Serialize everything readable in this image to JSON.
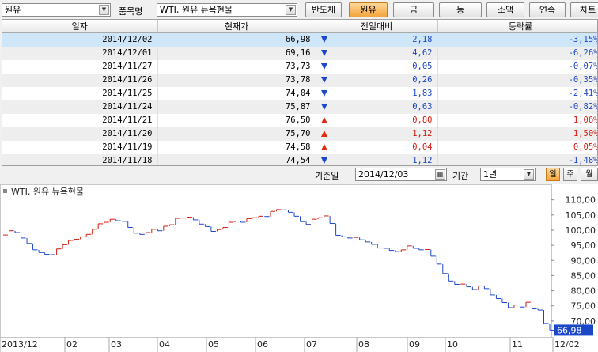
{
  "toolbar": {
    "category_value": "원유",
    "item_label": "품목명",
    "item_value": "WTI, 원유 뉴욕현물",
    "buttons": [
      {
        "label": "반도체",
        "active": false
      },
      {
        "label": "원유",
        "active": true
      },
      {
        "label": "금",
        "active": false
      },
      {
        "label": "동",
        "active": false
      },
      {
        "label": "소맥",
        "active": false
      },
      {
        "label": "연속",
        "active": false
      },
      {
        "label": "차트",
        "active": false
      }
    ]
  },
  "table": {
    "headers": [
      "일자",
      "현재가",
      "전일대비",
      "등락률"
    ],
    "rows": [
      {
        "date": "2014/12/02",
        "price": "66,98",
        "dir": "down",
        "change": "2,18",
        "rate": "-3,15%"
      },
      {
        "date": "2014/12/01",
        "price": "69,16",
        "dir": "down",
        "change": "4,62",
        "rate": "-6,26%"
      },
      {
        "date": "2014/11/27",
        "price": "73,73",
        "dir": "down",
        "change": "0,05",
        "rate": "-0,07%"
      },
      {
        "date": "2014/11/26",
        "price": "73,78",
        "dir": "down",
        "change": "0,26",
        "rate": "-0,35%"
      },
      {
        "date": "2014/11/25",
        "price": "74,04",
        "dir": "down",
        "change": "1,83",
        "rate": "-2,41%"
      },
      {
        "date": "2014/11/24",
        "price": "75,87",
        "dir": "down",
        "change": "0,63",
        "rate": "-0,82%"
      },
      {
        "date": "2014/11/21",
        "price": "76,50",
        "dir": "up",
        "change": "0,80",
        "rate": "1,06%"
      },
      {
        "date": "2014/11/20",
        "price": "75,70",
        "dir": "up",
        "change": "1,12",
        "rate": "1,50%"
      },
      {
        "date": "2014/11/19",
        "price": "74,58",
        "dir": "up",
        "change": "0,04",
        "rate": "0,05%"
      },
      {
        "date": "2014/11/18",
        "price": "74,54",
        "dir": "down",
        "change": "1,12",
        "rate": "-1,48%"
      }
    ]
  },
  "controls": {
    "base_date_label": "기준일",
    "base_date_value": "2014/12/03",
    "period_label": "기간",
    "period_value": "1년",
    "tabs": [
      {
        "label": "일",
        "active": true
      },
      {
        "label": "주",
        "active": false
      },
      {
        "label": "월",
        "active": false
      }
    ]
  },
  "chart_data": {
    "type": "line",
    "title": "WTI, 원유 뉴욕현물",
    "x": [
      "2013/12",
      "02",
      "03",
      "04",
      "05",
      "06",
      "07",
      "08",
      "09",
      "10",
      "11",
      "12/02"
    ],
    "ylim": [
      65,
      112
    ],
    "yticks": [
      "110,00",
      "105,00",
      "100,00",
      "95,00",
      "90,00",
      "85,00",
      "80,00",
      "75,00",
      "70,00"
    ],
    "last_value": "66,98",
    "series": [
      {
        "name": "WTI, 원유 뉴욕현물",
        "values": [
          98.4,
          99.8,
          99.2,
          97.4,
          95.6,
          93.5,
          92.6,
          92.0,
          91.9,
          93.8,
          95.2,
          96.6,
          97.0,
          97.8,
          98.6,
          100.3,
          102.1,
          102.6,
          103.6,
          103.1,
          102.9,
          100.9,
          99.0,
          98.6,
          99.2,
          100.3,
          99.8,
          101.3,
          101.8,
          103.9,
          104.0,
          104.3,
          103.4,
          102.0,
          101.2,
          99.6,
          100.2,
          100.9,
          102.6,
          103.0,
          102.6,
          103.8,
          104.1,
          104.6,
          104.5,
          106.2,
          106.8,
          106.7,
          105.9,
          104.6,
          102.8,
          101.9,
          103.6,
          104.1,
          104.7,
          102.2,
          98.3,
          97.8,
          97.4,
          97.6,
          96.8,
          96.1,
          95.3,
          94.1,
          94.0,
          93.3,
          92.9,
          93.5,
          94.8,
          94.0,
          93.5,
          93.6,
          91.4,
          88.8,
          85.7,
          83.2,
          82.1,
          82.2,
          81.3,
          80.4,
          81.6,
          80.7,
          78.6,
          77.4,
          76.1,
          74.4,
          75.3,
          74.6,
          76.2,
          74.0,
          73.6,
          69.2,
          66.98
        ]
      }
    ]
  }
}
